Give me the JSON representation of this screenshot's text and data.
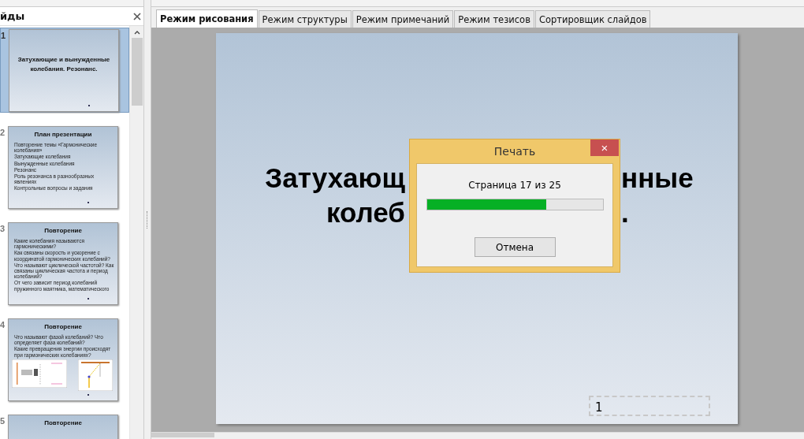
{
  "slides_panel": {
    "title": "йды",
    "thumbnails": [
      {
        "number": "1",
        "selected": true,
        "kind": "title",
        "title": "Затухающие и вынужденные колебания. Резонанс."
      },
      {
        "number": "2",
        "selected": false,
        "kind": "bullets",
        "title": "План презентации",
        "bullets": [
          "Повторение темы «Гармонические колебания»",
          "Затухающие колебания",
          "Вынужденные колебания",
          "Резонанс",
          "Роль резонанса в разнообразных явлениях",
          "Контрольные вопросы и задания"
        ]
      },
      {
        "number": "3",
        "selected": false,
        "kind": "bullets",
        "title": "Повторение",
        "bullets": [
          "Какие колебания называются гармоническими?",
          "Как связаны скорость и ускорение с координатой гармонических колебаний?",
          "Что называют циклической частотой? Как связаны циклическая частота и период колебаний?",
          "От чего зависит период колебаний пружинного маятника, математического"
        ]
      },
      {
        "number": "4",
        "selected": false,
        "kind": "bullets_pictures",
        "title": "Повторение",
        "bullets": [
          "Что называют фазой колебаний? Что определяет фаза колебаний?",
          "Какие превращения энергии происходят при гармонических колебаниях?"
        ]
      },
      {
        "number": "5",
        "selected": false,
        "kind": "title_only",
        "title": "Повторение"
      }
    ]
  },
  "tabs": [
    {
      "label": "Режим рисования",
      "selected": true
    },
    {
      "label": "Режим структуры",
      "selected": false
    },
    {
      "label": "Режим примечаний",
      "selected": false
    },
    {
      "label": "Режим тезисов",
      "selected": false
    },
    {
      "label": "Сортировщик слайдов",
      "selected": false
    }
  ],
  "slide": {
    "title_lines": [
      {
        "left": "Затухающ",
        "right": "нные"
      },
      {
        "left": "колеб",
        "right": "."
      }
    ],
    "page_number": "1"
  },
  "dialog": {
    "title": "Печать",
    "close": "×",
    "message": "Страница 17 из 25",
    "level": 0.68,
    "button": "Отмена"
  }
}
